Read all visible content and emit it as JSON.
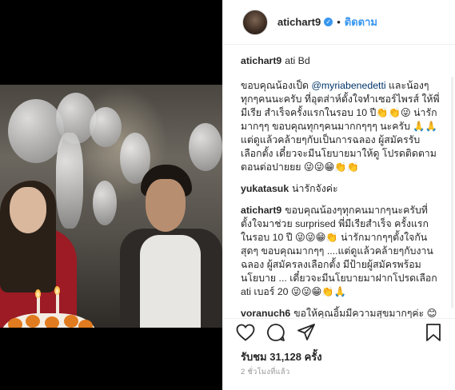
{
  "post": {
    "username": "atichart9",
    "verified_badge": "✓",
    "follow_dot": "•",
    "follow_label": "ติดตาม",
    "caption_header": "ati Bd"
  },
  "comments": [
    {
      "user": "",
      "text_pre": "ขอบคุณน้องเป็ด ",
      "mention": "@myriabenedetti",
      "text_post": " และน้องๆทุกๆคนนะครับ ที่อุตส่าห์ตั้งใจทำเซอร์ไพรส์ ให้พี่มีเรีย สำเร็จครั้งแรกในรอบ 10 ปี👏👏😜 น่ารักมากๆๆ ขอบคุณทุกๆคนมากกๆๆๆ นะครับ 🙏🙏 แต่ดูแล้วคล้ายๆกับเป็นการฉลอง ผู้สมัครรับเลือกตั้ง เดี๋ยวจะมีนโยบายมาให้ดู โปรดติดตามตอนต่อปายยย 😜😜😁👏👏"
    },
    {
      "user": "yukatasuk",
      "text": "น่ารักจังค่ะ"
    },
    {
      "user": "atichart9",
      "text": "ขอบคุณน้องๆทุกคนมากๆนะครับที่ตั้งใจมาช่วย surprised พี่มีเรียสำเร็จ ครั้งแรกในรอบ 10 ปี 😜😜😁👏 น่ารักมากๆๆตั้งใจกันสุดๆ ขอบคุณมากๆๆ ....แต่ดูแล้วคล้ายๆกับงานฉลอง ผู้สมัครลงเลือกตั้ง มีป้ายผู้สมัครพร้อมนโยบาย ... เดี๋ยวจะมีนโยบายมาฝากโปรดเลือก ati เบอร์ 20 😜😜😁👏🙏"
    },
    {
      "user": "voranuch6",
      "text": "ขอให้คุณอิ้มมีความสุขมากๆค่ะ 😊😊"
    }
  ],
  "actions": {
    "like_icon": "heart-icon",
    "comment_icon": "comment-icon",
    "share_icon": "share-icon",
    "save_icon": "bookmark-icon"
  },
  "stats": {
    "views": "รับชม 31,128 ครั้ง",
    "timestamp": "2 ชั่วโมงที่แล้ว"
  }
}
